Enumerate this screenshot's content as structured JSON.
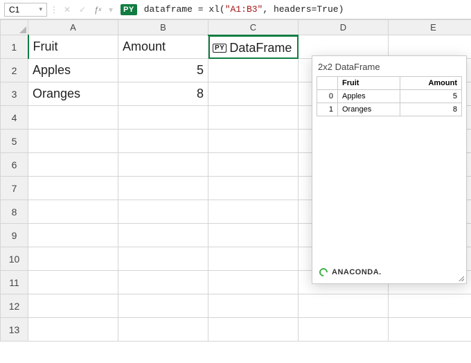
{
  "formula_bar": {
    "cell_ref": "C1",
    "py_badge": "PY",
    "t_var": "dataframe",
    "t_eq": " = ",
    "t_fn": "xl",
    "t_lparen": "(",
    "t_str": "\"A1:B3\"",
    "t_comma": ", ",
    "t_kw": "headers=True",
    "t_rparen": ")"
  },
  "columns": [
    "A",
    "B",
    "C",
    "D",
    "E"
  ],
  "row_headers": [
    "1",
    "2",
    "3",
    "4",
    "5",
    "6",
    "7",
    "8",
    "9",
    "10",
    "11",
    "12",
    "13"
  ],
  "cells": {
    "A1": "Fruit",
    "B1": "Amount",
    "A2": "Apples",
    "B2": "5",
    "A3": "Oranges",
    "B3": "8",
    "C1_icon": "PY",
    "C1_label": "DataFrame"
  },
  "card": {
    "title": "2x2 DataFrame",
    "cols": {
      "c1": "Fruit",
      "c2": "Amount"
    },
    "rows": [
      {
        "idx": "0",
        "fruit": "Apples",
        "amount": "5"
      },
      {
        "idx": "1",
        "fruit": "Oranges",
        "amount": "8"
      }
    ],
    "brand": "ANACONDA."
  },
  "chart_data": {
    "type": "table",
    "title": "2x2 DataFrame",
    "columns": [
      "Fruit",
      "Amount"
    ],
    "index": [
      0,
      1
    ],
    "rows": [
      [
        "Apples",
        5
      ],
      [
        "Oranges",
        8
      ]
    ]
  }
}
